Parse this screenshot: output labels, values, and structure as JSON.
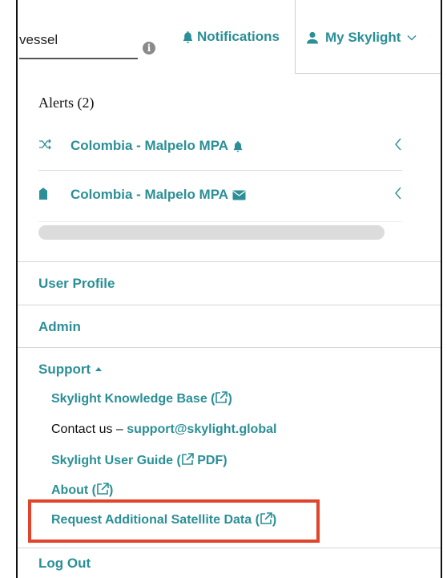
{
  "header": {
    "search_value": "vessel",
    "info_icon": "i",
    "notifications_label": "Notifications",
    "account_label": "My Skylight"
  },
  "alerts": {
    "title": "Alerts (2)",
    "items": [
      {
        "label": "Colombia - Malpelo MPA",
        "lead_icon": "shuffle-icon",
        "trail_icon": "bell-icon"
      },
      {
        "label": "Colombia - Malpelo MPA",
        "lead_icon": "marker-icon",
        "trail_icon": "envelope-icon"
      }
    ]
  },
  "menu": {
    "user_profile": "User Profile",
    "admin": "Admin",
    "support": "Support",
    "support_items": {
      "knowledge_base": "Skylight Knowledge Base (",
      "contact_prefix": "Contact us –",
      "contact_email": "support@skylight.global",
      "user_guide_prefix": "Skylight User Guide (",
      "user_guide_suffix": " PDF)",
      "about": "About (",
      "request_data": "Request Additional Satellite Data ("
    },
    "log_out": "Log Out"
  },
  "colors": {
    "accent": "#2a8f96",
    "highlight": "#e1442a"
  }
}
